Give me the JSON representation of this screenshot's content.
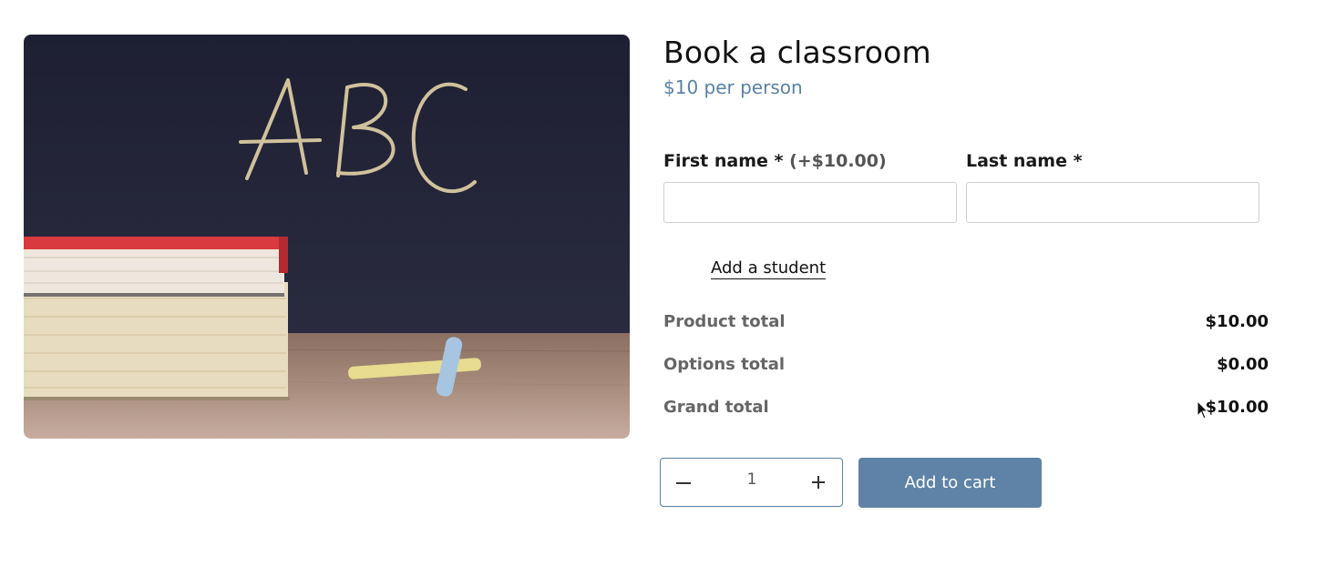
{
  "product": {
    "title": "Book a classroom",
    "price": "$10 per person",
    "image": {
      "subject": "chalkboard-with-books-and-chalk",
      "chalk_text": "ABC"
    }
  },
  "form": {
    "first_name_label": "First name *",
    "first_name_extra": "(+$10.00)",
    "last_name_label": "Last name *",
    "first_name_value": "",
    "last_name_value": "",
    "add_student_label": "Add a student"
  },
  "totals": {
    "product_label": "Product total",
    "product_value": "$10.00",
    "options_label": "Options total",
    "options_value": "$0.00",
    "grand_label": "Grand total",
    "grand_value": "$10.00"
  },
  "quantity": {
    "value": "1",
    "minus_icon": "minus-icon",
    "plus_icon": "plus-icon"
  },
  "cart": {
    "button_label": "Add to cart"
  },
  "colors": {
    "accent": "#5e83a6",
    "price_text": "#5a82a6",
    "chalkboard": "#23243a"
  }
}
